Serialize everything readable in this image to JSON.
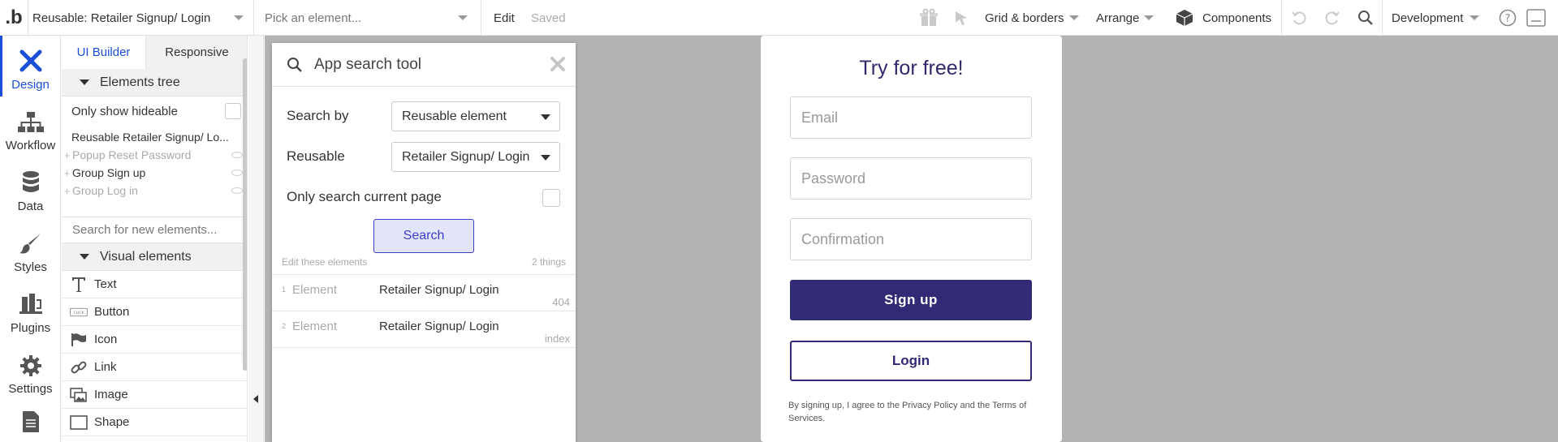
{
  "topbar": {
    "logo": ".b",
    "page_selector": "Reusable: Retailer Signup/ Login",
    "element_picker": "Pick an element...",
    "edit_label": "Edit",
    "saved_label": "Saved",
    "grid_label": "Grid & borders",
    "arrange_label": "Arrange",
    "components_label": "Components",
    "environment": "Development"
  },
  "leftnav": {
    "items": [
      {
        "label": "Design",
        "icon": "design-icon"
      },
      {
        "label": "Workflow",
        "icon": "workflow-icon"
      },
      {
        "label": "Data",
        "icon": "data-icon"
      },
      {
        "label": "Styles",
        "icon": "styles-icon"
      },
      {
        "label": "Plugins",
        "icon": "plugins-icon"
      },
      {
        "label": "Settings",
        "icon": "gear-icon"
      },
      {
        "label": "",
        "icon": "document-icon"
      }
    ]
  },
  "panel": {
    "tabs": [
      "UI Builder",
      "Responsive"
    ],
    "elements_tree_title": "Elements tree",
    "only_show_hideable": "Only show hideable",
    "tree": [
      {
        "label": "Reusable Retailer Signup/ Lo...",
        "faded": false
      },
      {
        "label": "Popup Reset Password",
        "faded": true
      },
      {
        "label": "Group Sign up",
        "faded": false
      },
      {
        "label": "Group Log in",
        "faded": true
      }
    ],
    "search_placeholder": "Search for new elements...",
    "visual_elements_title": "Visual elements",
    "visual_elements": [
      {
        "label": "Text",
        "icon": "text-icon"
      },
      {
        "label": "Button",
        "icon": "button-icon"
      },
      {
        "label": "Icon",
        "icon": "flag-icon"
      },
      {
        "label": "Link",
        "icon": "link-icon"
      },
      {
        "label": "Image",
        "icon": "image-icon"
      },
      {
        "label": "Shape",
        "icon": "shape-icon"
      }
    ]
  },
  "search_tool": {
    "title": "App search tool",
    "search_by_label": "Search by",
    "search_by_value": "Reusable element",
    "reusable_label": "Reusable",
    "reusable_value": "Retailer Signup/ Login",
    "only_current_label": "Only search current page",
    "search_button": "Search",
    "edit_hint": "Edit these elements",
    "count": "2 things",
    "results": [
      {
        "num": "1",
        "kind": "Element",
        "name": "Retailer Signup/ Login",
        "page": "404"
      },
      {
        "num": "2",
        "kind": "Element",
        "name": "Retailer Signup/ Login",
        "page": "index"
      }
    ]
  },
  "signup": {
    "title": "Try for free!",
    "email_placeholder": "Email",
    "password_placeholder": "Password",
    "confirmation_placeholder": "Confirmation",
    "signup_button": "Sign up",
    "login_button": "Login",
    "terms_text": "By signing up, I agree to the Privacy Policy and the Terms of Services."
  },
  "colors": {
    "accent": "#1b4fd8",
    "brand_purple": "#312a75",
    "canvas_bg": "#b3b3b3"
  }
}
